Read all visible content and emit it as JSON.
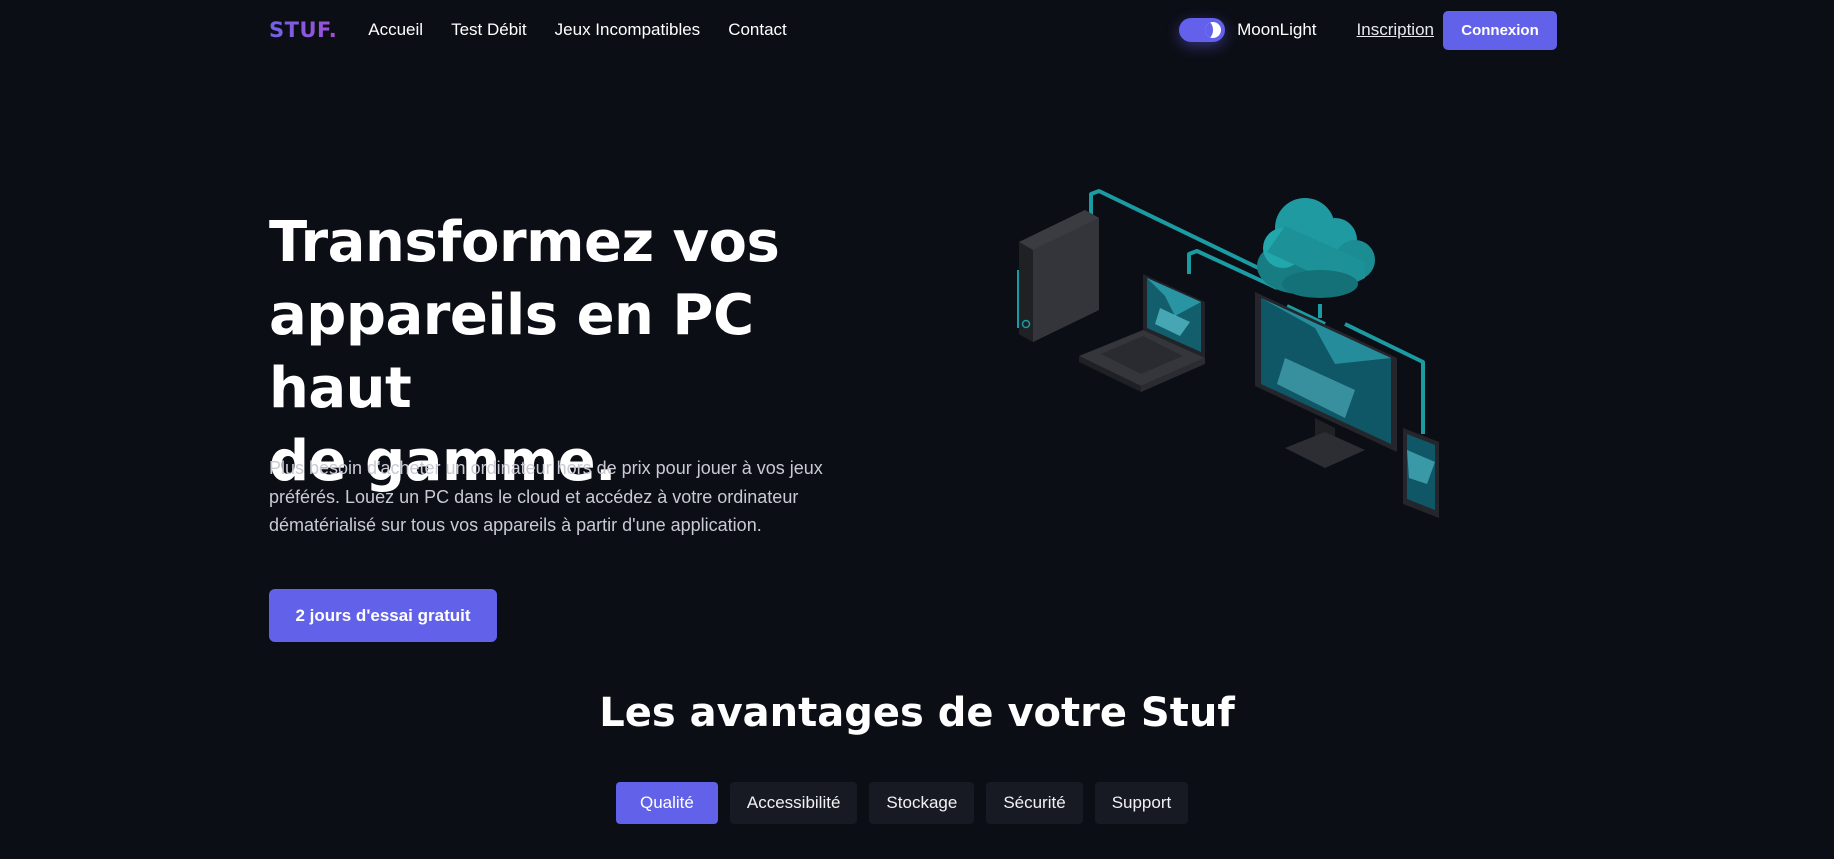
{
  "nav": {
    "logo": "STUF",
    "logo_dot": ".",
    "links": [
      "Accueil",
      "Test Débit",
      "Jeux Incompatibles",
      "Contact"
    ],
    "theme_label": "MoonLight",
    "signup": "Inscription",
    "login": "Connexion"
  },
  "hero": {
    "title_lines": [
      "Transformez vos",
      "appareils en PC haut",
      "de gamme."
    ],
    "description_lines": [
      "Plus besoin d'acheter un ordinateur hors de prix pour jouer à vos jeux",
      "préférés. Louez un PC dans le cloud et accédez à votre ordinateur",
      "dématérialisé sur tous vos appareils à partir d'une application."
    ],
    "cta": "2 jours d'essai gratuit"
  },
  "advantages": {
    "title": "Les avantages de votre Stuf",
    "tabs": [
      "Qualité",
      "Accessibilité",
      "Stockage",
      "Sécurité",
      "Support"
    ],
    "active_tab": "Qualité"
  },
  "colors": {
    "background": "#0c0e16",
    "accent": "#6161ea",
    "teal": "#1e9aa0"
  }
}
